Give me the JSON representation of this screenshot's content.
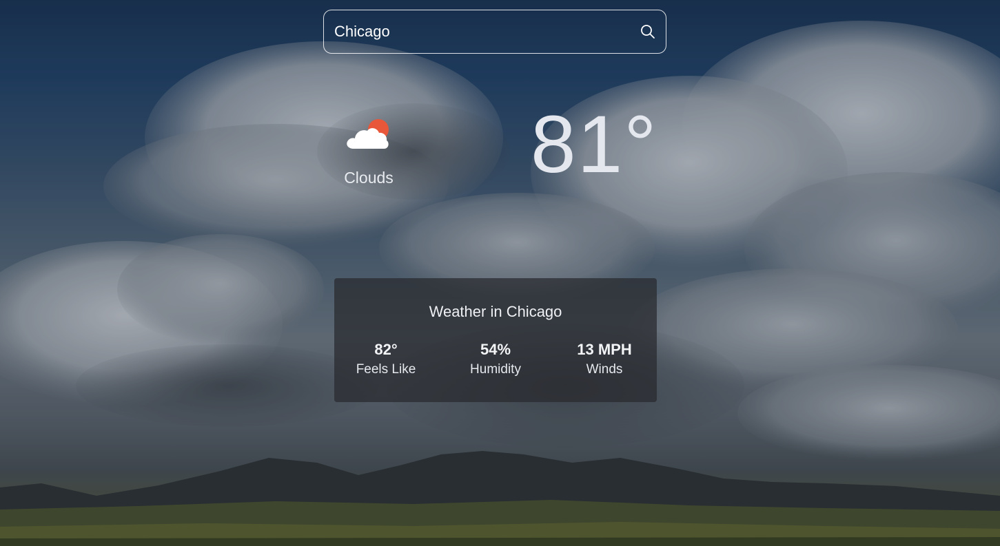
{
  "search": {
    "value": "Chicago",
    "placeholder": ""
  },
  "current": {
    "condition": "Clouds",
    "condition_icon": "sun-behind-cloud-icon",
    "temperature": "81°"
  },
  "details": {
    "title": "Weather in Chicago",
    "stats": [
      {
        "value": "82°",
        "label": "Feels Like"
      },
      {
        "value": "54%",
        "label": "Humidity"
      },
      {
        "value": "13 MPH",
        "label": "Winds"
      }
    ]
  },
  "colors": {
    "sun": "#e8573a",
    "cloud": "#ffffff",
    "text": "#ffffff"
  }
}
